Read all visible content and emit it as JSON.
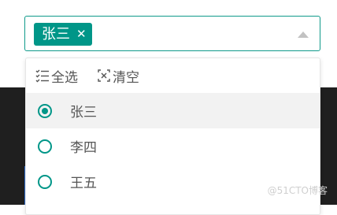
{
  "select": {
    "selected_tag": "张三",
    "tag_close": "✕"
  },
  "toolbar": {
    "select_all": "全选",
    "clear": "清空"
  },
  "options": [
    {
      "label": "张三",
      "checked": true
    },
    {
      "label": "李四",
      "checked": false
    },
    {
      "label": "王五",
      "checked": false
    }
  ],
  "watermark": "@51CTO博客",
  "colors": {
    "accent": "#009688",
    "border": "#0f9a8a",
    "dark_background": "#1f1f1f"
  }
}
